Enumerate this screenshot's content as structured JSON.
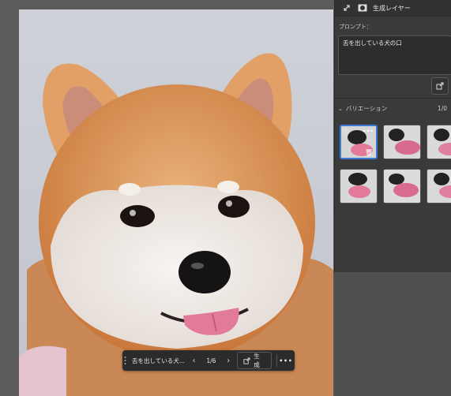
{
  "panel": {
    "header_title": "生成レイヤー",
    "prompt_label": "プロンプト：",
    "prompt_value": "舌を出している犬の口",
    "variations_label": "バリエーション",
    "variations_count": "1/0",
    "variation_count_total": 6
  },
  "taskbar": {
    "prompt_text": "舌を出している犬...",
    "counter": "1/6",
    "generate_label": "生成"
  }
}
